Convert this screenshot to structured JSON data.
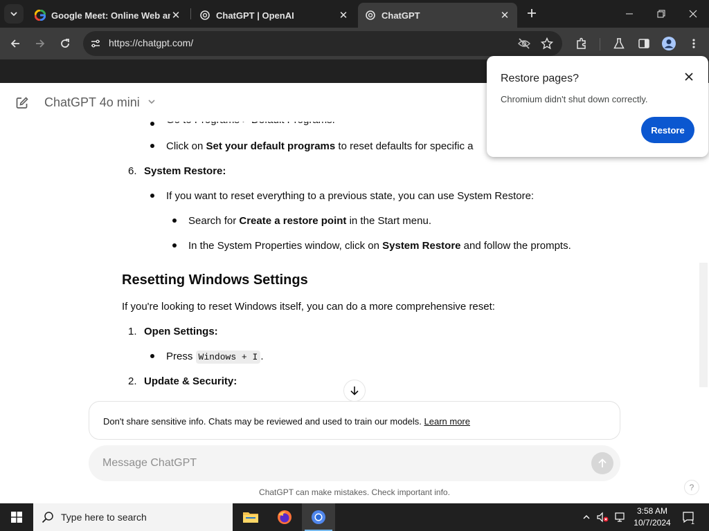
{
  "browser": {
    "tabs": [
      {
        "title": "Google Meet: Online Web and",
        "favicon": "google-g-icon"
      },
      {
        "title": "ChatGPT | OpenAI",
        "favicon": "openai-icon"
      },
      {
        "title": "ChatGPT",
        "favicon": "openai-icon",
        "active": true
      }
    ],
    "url": "https://chatgpt.com/"
  },
  "header": {
    "model": "ChatGPT 4o mini"
  },
  "content": {
    "partial_line": "Go to Programs > Default Programs.",
    "item1_pre": "Click on ",
    "item1_bold": "Set your default programs",
    "item1_post": " to reset defaults for specific a",
    "item6_num": "6.",
    "item6_title": "System Restore:",
    "item6_bullet": "If you want to reset everything to a previous state, you can use System Restore:",
    "sub1_pre": "Search for ",
    "sub1_bold": "Create a restore point",
    "sub1_post": " in the Start menu.",
    "sub2_pre": "In the System Properties window, click on ",
    "sub2_bold": "System Restore",
    "sub2_post": " and follow the prompts.",
    "heading": "Resetting Windows Settings",
    "intro": "If you're looking to reset Windows itself, you can do a more comprehensive reset:",
    "step1_num": "1.",
    "step1_title": "Open Settings:",
    "step1_press": "Press ",
    "step1_code": "Windows + I",
    "step1_end": ".",
    "step2_num": "2.",
    "step2_title": "Update & Security:"
  },
  "notice": {
    "text": "Don't share sensitive info. Chats may be reviewed and used to train our models.",
    "link": "Learn more"
  },
  "composer": {
    "placeholder": "Message ChatGPT"
  },
  "footer": {
    "note": "ChatGPT can make mistakes. Check important info.",
    "help": "?"
  },
  "popup": {
    "title": "Restore pages?",
    "body": "Chromium didn't shut down correctly.",
    "button": "Restore"
  },
  "taskbar": {
    "search_placeholder": "Type here to search",
    "time": "3:58 AM",
    "date": "10/7/2024",
    "notification_count": "1"
  }
}
